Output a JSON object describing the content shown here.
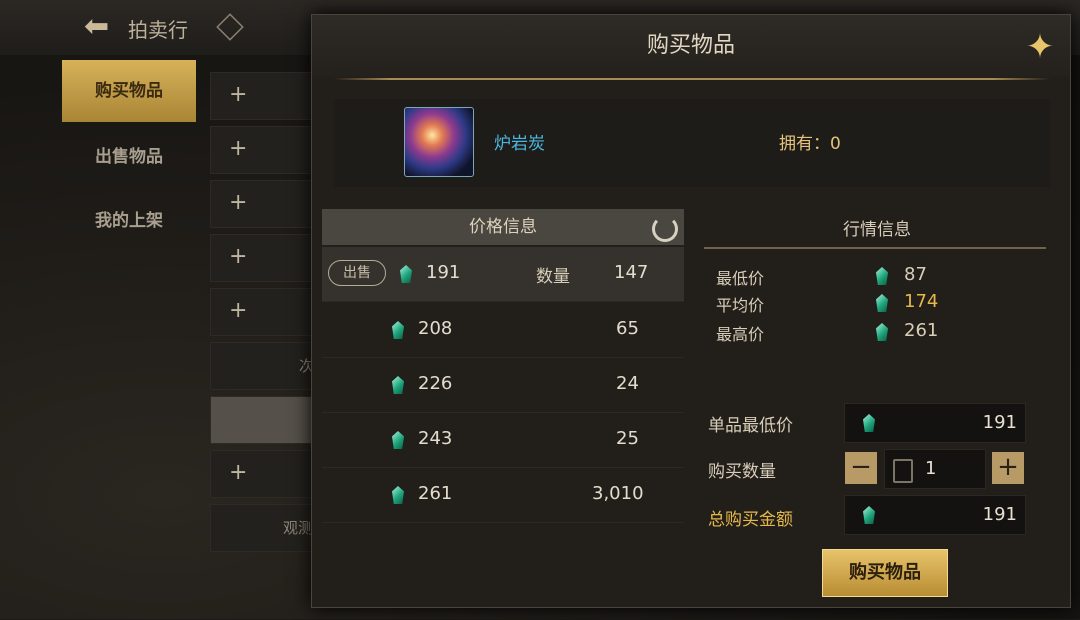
{
  "topbar": {
    "title": "拍卖行"
  },
  "sidebar": {
    "items": [
      {
        "label": "购买物品",
        "active": true
      },
      {
        "label": "出售物品",
        "active": false
      },
      {
        "label": "我的上架",
        "active": false
      }
    ]
  },
  "slots": {
    "fragment_1": "次",
    "fragment_2": "观测"
  },
  "modal": {
    "title": "购买物品",
    "item": {
      "name": "炉岩炭",
      "owned_label": "拥有：0"
    },
    "price_info": {
      "header": "价格信息",
      "sell_badge": "出售",
      "quantity_label": "数量",
      "rows": [
        {
          "price": "191",
          "qty": "147"
        },
        {
          "price": "208",
          "qty": "65"
        },
        {
          "price": "226",
          "qty": "24"
        },
        {
          "price": "243",
          "qty": "25"
        },
        {
          "price": "261",
          "qty": "3,010"
        }
      ]
    },
    "market_info": {
      "header": "行情信息",
      "rows": [
        {
          "label": "最低价",
          "value": "87"
        },
        {
          "label": "平均价",
          "value": "174"
        },
        {
          "label": "最高价",
          "value": "261"
        }
      ]
    },
    "purchase": {
      "unit_min_label": "单品最低价",
      "unit_min_value": "191",
      "qty_label": "购买数量",
      "qty_value": "1",
      "total_label": "总购买金额",
      "total_value": "191",
      "buy_label": "购买物品"
    }
  },
  "colors": {
    "accent_gold": "#d7b25a",
    "gem": "#1fa57d",
    "item_name": "#4bb7e0"
  }
}
